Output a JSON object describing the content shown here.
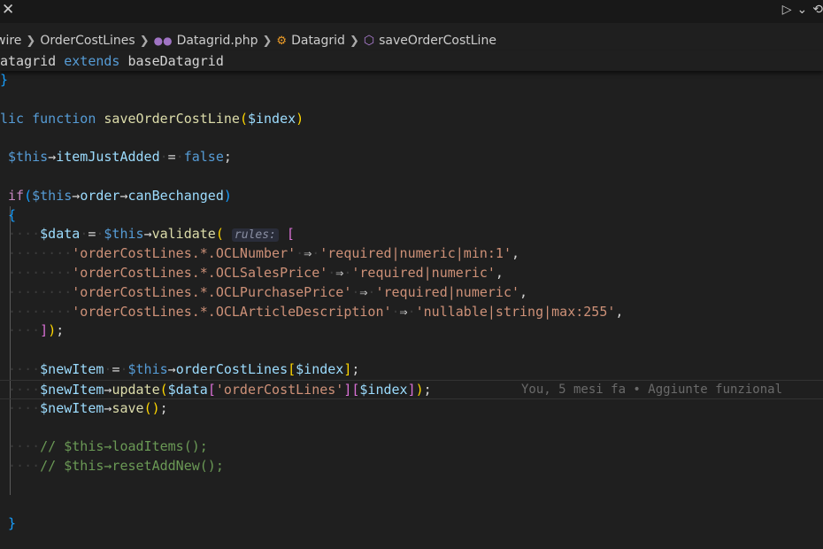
{
  "topbar": {
    "close_glyph": "✕",
    "run_glyph": "▷",
    "chevron_glyph": "⌄",
    "timeline_glyph": "⟲"
  },
  "breadcrumb": {
    "items": [
      "wire",
      "OrderCostLines",
      "Datagrid.php",
      "Datagrid",
      "saveOrderCostLine"
    ]
  },
  "sticky": {
    "class_name": "atagrid",
    "extends_kw": "extends",
    "parent": "baseDatagrid"
  },
  "code": {
    "l0": "}",
    "l2_kw1": "lic",
    "l2_kw2": "function",
    "l2_fn": "saveOrderCostLine",
    "l2_param": "$index",
    "l4_this": "$this",
    "l4_prop": "itemJustAdded",
    "l4_val": "false",
    "l6_if": "if",
    "l6_this": "$this",
    "l6_prop": "order",
    "l6_fn": "canBechanged",
    "l8_var": "$data",
    "l8_this": "$this",
    "l8_fn": "validate",
    "l8_hint": "rules:",
    "r1_key": "'orderCostLines.*.OCLNumber'",
    "r1_val": "'required|numeric|min:1'",
    "r2_key": "'orderCostLines.*.OCLSalesPrice'",
    "r2_val": "'required|numeric'",
    "r3_key": "'orderCostLines.*.OCLPurchasePrice'",
    "r3_val": "'required|numeric'",
    "r4_key": "'orderCostLines.*.OCLArticleDescription'",
    "r4_val": "'nullable|string|max:255'",
    "l15_var": "$newItem",
    "l15_this": "$this",
    "l15_prop": "orderCostLines",
    "l15_idx": "$index",
    "l16_var": "$newItem",
    "l16_fn": "update",
    "l16_data": "$data",
    "l16_key": "'orderCostLines'",
    "l16_idx": "$index",
    "blame": "You, 5 mesi fa • Aggiunte funzional",
    "l17_var": "$newItem",
    "l17_fn": "save",
    "c1": "// $this→loadItems();",
    "c2": "// $this→resetAddNew();",
    "close": "}"
  }
}
